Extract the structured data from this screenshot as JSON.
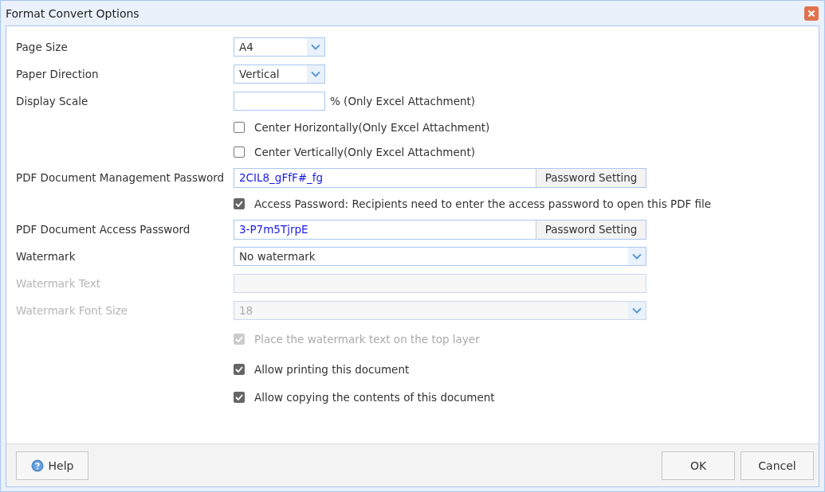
{
  "window": {
    "title": "Format Convert Options"
  },
  "rows": [
    {
      "kind": "short_select",
      "label": "Page Size",
      "value": "A4",
      "disabled": false
    },
    {
      "kind": "short_select",
      "label": "Paper Direction",
      "value": "Vertical",
      "disabled": false
    },
    {
      "kind": "scale",
      "label": "Display Scale",
      "value": "",
      "suffix": "% (Only Excel Attachment)",
      "disabled": false
    },
    {
      "kind": "checkbox",
      "text": "Center Horizontally(Only Excel Attachment)",
      "checked": false,
      "disabled": false
    },
    {
      "kind": "checkbox",
      "text": "Center Vertically(Only Excel Attachment)",
      "checked": false,
      "disabled": false
    },
    {
      "kind": "password",
      "label": "PDF Document Management Password",
      "value": "2CIL8_gFfF#_fg",
      "button": "Password Setting"
    },
    {
      "kind": "checkbox",
      "text": "Access Password: Recipients need to enter the access password to open this PDF file",
      "checked": true,
      "disabled": false
    },
    {
      "kind": "password",
      "label": "PDF Document Access Password",
      "value": "3-P7m5TjrpE",
      "button": "Password Setting"
    },
    {
      "kind": "select",
      "label": "Watermark",
      "value": "No watermark",
      "disabled": false
    },
    {
      "kind": "text",
      "label": "Watermark Text",
      "value": "",
      "disabled": true
    },
    {
      "kind": "select",
      "label": "Watermark Font Size",
      "value": "18",
      "disabled": true
    },
    {
      "kind": "checkbox",
      "text": "Place the watermark text on the top layer",
      "checked": true,
      "disabled": true
    },
    {
      "kind": "checkbox",
      "text": "Allow printing this document",
      "checked": true,
      "disabled": false
    },
    {
      "kind": "checkbox",
      "text": "Allow copying the contents of this document",
      "checked": true,
      "disabled": false
    }
  ],
  "footer": {
    "help": "Help",
    "ok": "OK",
    "cancel": "Cancel"
  }
}
